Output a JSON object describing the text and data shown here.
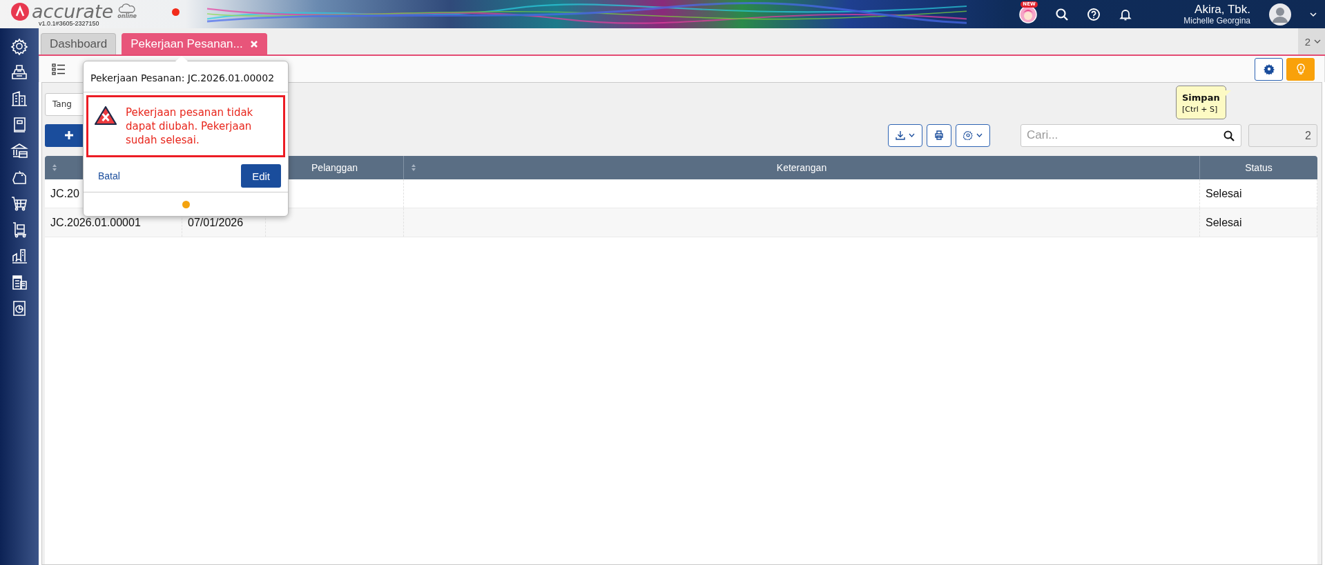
{
  "header": {
    "logo_text": "accurate",
    "logo_subtext": "online",
    "version": "v1.0.1#3605-2327150",
    "new_badge": "NEW",
    "company": "Akira, Tbk.",
    "user": "Michelle Georgina"
  },
  "tabs": [
    {
      "label": "Dashboard",
      "selected": false,
      "closable": false
    },
    {
      "label": "Pekerjaan Pesanan...",
      "selected": true,
      "closable": true
    }
  ],
  "tab_count": "2",
  "filter": {
    "value": "Tang"
  },
  "search": {
    "placeholder": "Cari..."
  },
  "record_count": "2",
  "table": {
    "columns": [
      {
        "kind": "number",
        "sort_icon": true
      },
      {
        "kind": "customer",
        "label": "Pelanggan",
        "sort_icon": false
      },
      {
        "kind": "description",
        "label": "Keterangan",
        "sort_icon": true
      },
      {
        "kind": "status",
        "label": "Status",
        "sort_icon": false
      }
    ],
    "rows": [
      {
        "number": "JC.20",
        "status": "Selesai"
      },
      {
        "number": "JC.2026.01.00001",
        "date": "07/01/2026",
        "status": "Selesai"
      }
    ]
  },
  "popup": {
    "title": "Pekerjaan Pesanan: JC.2026.01.00002",
    "message": "Pekerjaan pesanan tidak dapat diubah. Pekerjaan sudah selesai.",
    "cancel": "Batal",
    "confirm": "Edit"
  },
  "tooltip": {
    "title": "Simpan",
    "shortcut": "[Ctrl + S]"
  }
}
